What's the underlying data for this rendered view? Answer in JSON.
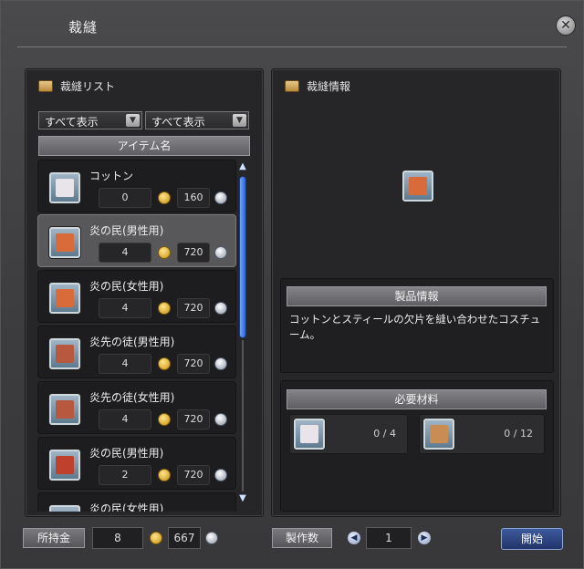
{
  "window": {
    "title": "裁縫",
    "close_icon": "close-icon"
  },
  "left_panel": {
    "header": "裁縫リスト",
    "filter1": "すべて表示",
    "filter2": "すべて表示",
    "column_header": "アイテム名",
    "items": [
      {
        "name": "コットン",
        "qty": "0",
        "price": "160",
        "color": "#e9e4ea",
        "selected": false
      },
      {
        "name": "炎の民(男性用)",
        "qty": "4",
        "price": "720",
        "color": "#d96a3a",
        "selected": true
      },
      {
        "name": "炎の民(女性用)",
        "qty": "4",
        "price": "720",
        "color": "#d96a3a",
        "selected": false
      },
      {
        "name": "炎先の徒(男性用)",
        "qty": "4",
        "price": "720",
        "color": "#b8583f",
        "selected": false
      },
      {
        "name": "炎先の徒(女性用)",
        "qty": "4",
        "price": "720",
        "color": "#b8583f",
        "selected": false
      },
      {
        "name": "炎の民(男性用)",
        "qty": "2",
        "price": "720",
        "color": "#c0402e",
        "selected": false
      },
      {
        "name": "炎の民(女性用)",
        "qty": "",
        "price": "",
        "color": "#c0402e",
        "selected": false
      }
    ]
  },
  "right_panel": {
    "header": "裁縫情報",
    "product_info_header": "製品情報",
    "description": "コットンとスティールの欠片を縫い合わせたコスチューム。",
    "materials_header": "必要材料",
    "materials": [
      {
        "count": "0 / 4",
        "color": "#e9e4ea"
      },
      {
        "count": "0 / 12",
        "color": "#c98c52"
      }
    ]
  },
  "footer": {
    "money_label": "所持金",
    "gold": "8",
    "silver": "667",
    "craft_count_label": "製作数",
    "quantity": "1",
    "start_label": "開始"
  }
}
